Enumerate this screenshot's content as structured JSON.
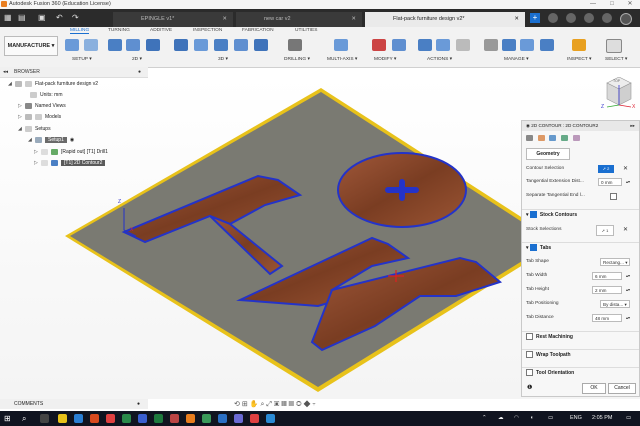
{
  "window": {
    "title": "Autodesk Fusion 360 (Education License)",
    "controls": [
      "—",
      "□",
      "✕"
    ]
  },
  "tabs": [
    {
      "label": "EPINGLE v1*",
      "active": false
    },
    {
      "label": "new car v2",
      "active": false
    },
    {
      "label": "Flat-pack furniture design v2*",
      "active": true
    }
  ],
  "ribbon": {
    "workspace": "MANUFACTURE ▾",
    "subtabs": [
      "MILLING",
      "TURNING",
      "ADDITIVE",
      "INSPECTION",
      "FABRICATION",
      "UTILITIES"
    ],
    "groups": [
      "SETUP ▾",
      "2D ▾",
      "3D ▾",
      "DRILLING ▾",
      "MULTI-AXIS ▾",
      "MODIFY ▾",
      "ACTIONS ▾",
      "MANAGE ▾",
      "INSPECT ▾",
      "SELECT ▾"
    ]
  },
  "browser": {
    "header": "BROWSER",
    "items": [
      {
        "label": "Flat-pack furniture design v2"
      },
      {
        "label": "Units: mm"
      },
      {
        "label": "Named Views"
      },
      {
        "label": "Models"
      },
      {
        "label": "Setups"
      },
      {
        "label": "Setup1"
      },
      {
        "label": "[Rapid out] [T1] Drill1"
      },
      {
        "label": "[T1] 2D Contour2"
      }
    ]
  },
  "panel": {
    "title": "2D CONTOUR : 2D CONTOUR2",
    "tab": "Geometry",
    "contour_selection": "Contour Selection",
    "tangential_extension": "Tangential Extension Dist...",
    "tangential_extension_value": "0 mm",
    "separate_tangential": "Separate Tangential End l...",
    "stock_contours": "Stock Contours",
    "stock_selections": "Stock Selections",
    "tabs_section": "Tabs",
    "tab_shape": "Tab Shape",
    "tab_shape_value": "Rectang... ▾",
    "tab_width": "Tab Width",
    "tab_width_value": "6 mm",
    "tab_height": "Tab Height",
    "tab_height_value": "2 mm",
    "tab_positioning": "Tab Positioning",
    "tab_positioning_value": "By dista... ▾",
    "tab_distance": "Tab Distance",
    "tab_distance_value": "48 mm",
    "rest_machining": "Rest Machining",
    "wrap_toolpath": "Wrap Toolpath",
    "tool_orientation": "Tool Orientation",
    "ok": "OK",
    "cancel": "Cancel"
  },
  "comments": {
    "label": "COMMENTS"
  },
  "viewcube": {
    "top": "TOP",
    "x": "X",
    "y": "Y",
    "z": "Z"
  },
  "taskbar": {
    "lang": "ENG",
    "time": "2:05 PM"
  },
  "colors": {
    "ribbon_active": "#1a6fd0",
    "stock_yellow": "#e8c21a",
    "toolpath_blue": "#2433c8",
    "wood": "#8a4a2a"
  }
}
